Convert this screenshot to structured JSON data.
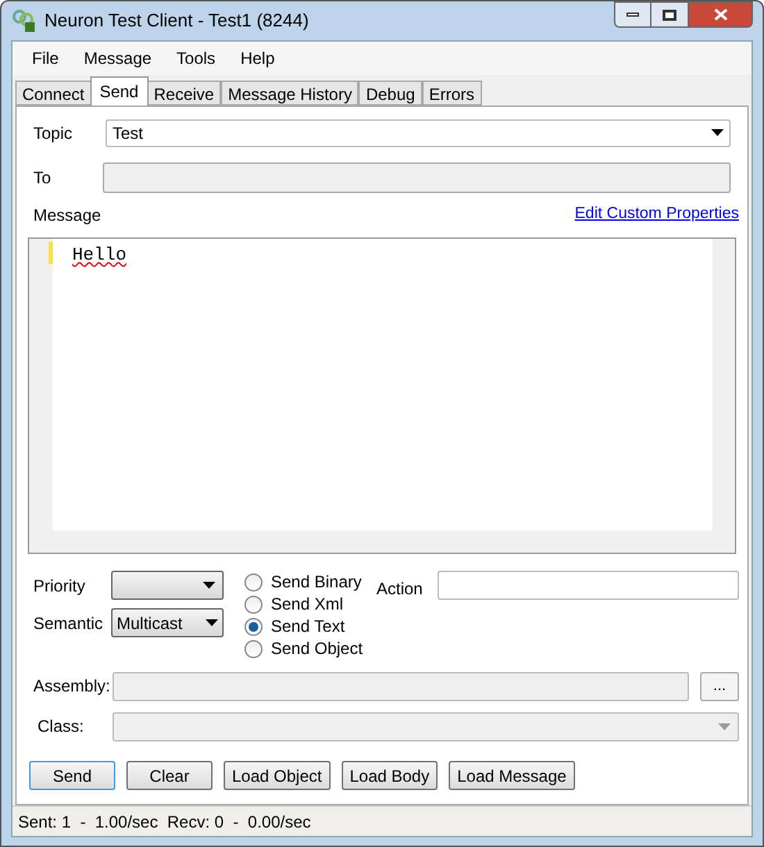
{
  "window": {
    "title": "Neuron Test Client - Test1 (8244)"
  },
  "menu": [
    {
      "label": "File"
    },
    {
      "label": "Message"
    },
    {
      "label": "Tools"
    },
    {
      "label": "Help"
    }
  ],
  "tabs": [
    {
      "label": "Connect",
      "selected": false
    },
    {
      "label": "Send",
      "selected": true
    },
    {
      "label": "Receive",
      "selected": false
    },
    {
      "label": "Message History",
      "selected": false
    },
    {
      "label": "Debug",
      "selected": false
    },
    {
      "label": "Errors",
      "selected": false
    }
  ],
  "topic": {
    "label": "Topic",
    "value": "Test"
  },
  "to": {
    "label": "To",
    "disabled": true
  },
  "message": {
    "label": "Message",
    "link": "Edit Custom Properties",
    "text": "Hello"
  },
  "priority": {
    "label": "Priority"
  },
  "semantic": {
    "label": "Semantic",
    "value": "Multicast"
  },
  "send_modes": [
    {
      "label": "Send Binary",
      "selected": false
    },
    {
      "label": "Send Xml",
      "selected": false
    },
    {
      "label": "Send Text",
      "selected": true
    },
    {
      "label": "Send Object",
      "selected": false
    }
  ],
  "action": {
    "label": "Action"
  },
  "assembly": {
    "label": "Assembly:",
    "browse": "..."
  },
  "class": {
    "label": "Class:"
  },
  "buttons": [
    {
      "label": "Send",
      "default": true
    },
    {
      "label": "Clear",
      "default": false
    },
    {
      "label": "Load Object",
      "default": false
    },
    {
      "label": "Load Body",
      "default": false
    },
    {
      "label": "Load Message",
      "default": false
    }
  ],
  "status_bar": {
    "text": "Sent: 1  -  1.00/sec  Recv: 0  -  0.00/sec"
  }
}
